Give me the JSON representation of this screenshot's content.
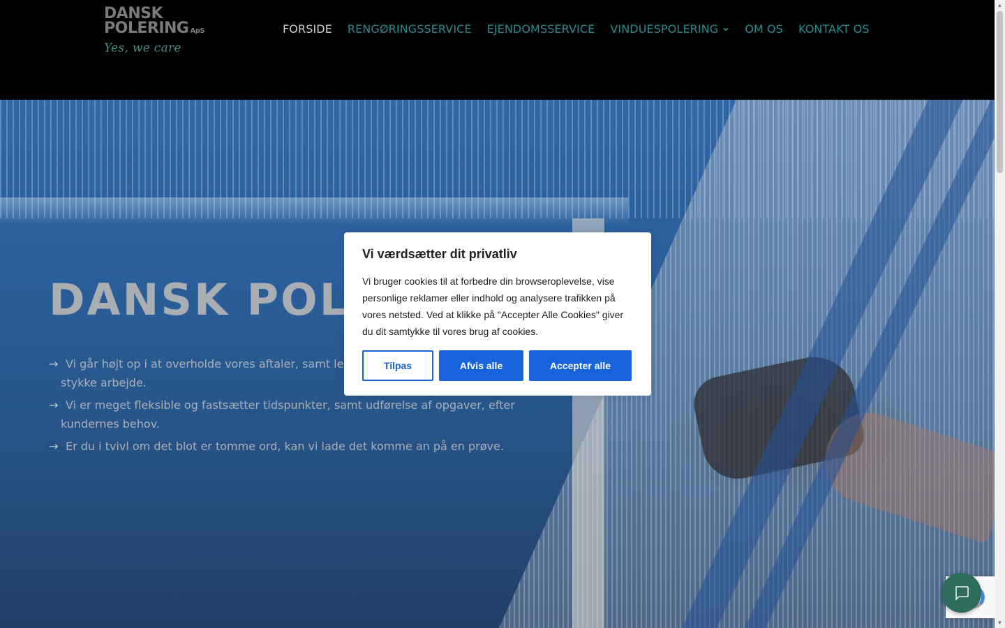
{
  "header": {
    "logo": {
      "line1": "DANSK",
      "line2": "POLERING",
      "suffix": "ApS",
      "tagline": "Yes, we care"
    },
    "nav": [
      {
        "label": "FORSIDE",
        "active": true
      },
      {
        "label": "RENGØRINGSSERVICE",
        "active": false
      },
      {
        "label": "EJENDOMSSERVICE",
        "active": false
      },
      {
        "label": "VINDUESPOLERING",
        "active": false,
        "has_dropdown": true
      },
      {
        "label": "OM OS",
        "active": false
      },
      {
        "label": "KONTAKT OS",
        "active": false
      }
    ]
  },
  "hero": {
    "title": "DANSK POLERING",
    "bullets": [
      {
        "line1": "Vi går højt op i at overholde vores aftaler, samt levere et ordentligt og grundigt",
        "line2": "stykke arbejde."
      },
      {
        "line1": "Vi er meget fleksible og fastsætter tidspunkter, samt udførelse af opgaver, efter",
        "line2": "kundernes behov."
      },
      {
        "line1": "Er du i tvivl om det blot er tomme ord, kan vi lade det komme an på en prøve.",
        "line2": ""
      }
    ],
    "bullet_icon": "arrow-right-icon"
  },
  "cookie_modal": {
    "title": "Vi værdsætter dit privatliv",
    "body": "Vi bruger cookies til at forbedre din browseroplevelse, vise personlige reklamer eller indhold og analysere trafikken på vores netsted. Ved at klikke på \"Accepter Alle Cookies\" giver du dit samtykke til vores brug af cookies.",
    "buttons": {
      "customize": "Tilpas",
      "reject": "Afvis alle",
      "accept": "Accepter alle"
    }
  },
  "colors": {
    "nav_link": "#2c8a8a",
    "nav_active": "#cfcfcf",
    "button_primary": "#1863dc",
    "chat_button": "#2d6b5d"
  },
  "widgets": {
    "chat_icon": "chat-bubble-icon",
    "recaptcha_icon": "recaptcha-icon"
  }
}
